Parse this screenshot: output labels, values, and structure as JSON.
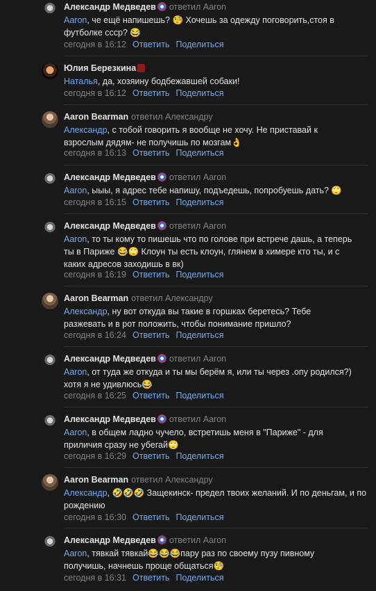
{
  "comments": [
    {
      "author": "Александр Медведев",
      "reply_to": "ответил Aaron",
      "mention": "Aaron",
      "text": ", че ещё напишешь? 🧐 Хочешь за одежду поговорить,стоя в футболке ссср? 😂",
      "date": "сегодня в 16:12",
      "reply_label": "Ответить",
      "share_label": "Поделиться"
    },
    {
      "author": "Юлия Березкина",
      "reply_to": "",
      "mention": "Наталья",
      "text": ", да, хозяину бодбежавшей собаки!",
      "date": "сегодня в 16:12",
      "reply_label": "Ответить",
      "share_label": "Поделиться"
    },
    {
      "author": "Aaron Bearman",
      "reply_to": "ответил Александру",
      "mention": "Александр",
      "text": ", с тобой говорить я вообще не хочу. Не приставай к взрослым дядям- не получишь по мозгам👌",
      "date": "сегодня в 16:13",
      "reply_label": "Ответить",
      "share_label": "Поделиться"
    },
    {
      "author": "Александр Медведев",
      "reply_to": "ответил Aaron",
      "mention": "Aaron",
      "text": ", ыыы, я адрес тебе напишу, подъедешь, попробуешь дать? 🙄",
      "date": "сегодня в 16:15",
      "reply_label": "Ответить",
      "share_label": "Поделиться"
    },
    {
      "author": "Александр Медведев",
      "reply_to": "ответил Aaron",
      "mention": "Aaron",
      "text": ", то ты кому то пишешь что по голове при встрече дашь, а теперь ты в Париже 😂🙄 Клоун ты есть клоун, глянем в химере кто ты, и с каких адресов заходишь в вк)",
      "date": "сегодня в 16:19",
      "reply_label": "Ответить",
      "share_label": "Поделиться"
    },
    {
      "author": "Aaron Bearman",
      "reply_to": "ответил Александру",
      "mention": "Александр",
      "text": ", ну вот откуда вы такие в горшках беретесь? Тебе разжевать и в рот положить, чтобы понимание пришло?",
      "date": "сегодня в 16:24",
      "reply_label": "Ответить",
      "share_label": "Поделиться"
    },
    {
      "author": "Александр Медведев",
      "reply_to": "ответил Aaron",
      "mention": "Aaron",
      "text": ", от туда же откуда и ты мы берём я, или ты через .опу родился?) хотя я не удивлюсь😂",
      "date": "сегодня в 16:25",
      "reply_label": "Ответить",
      "share_label": "Поделиться"
    },
    {
      "author": "Александр Медведев",
      "reply_to": "ответил Aaron",
      "mention": "Aaron",
      "text": ", в общем ладно чучело, встретишь меня в \"Париже\" - для приличия сразу не убегай🙄",
      "date": "сегодня в 16:29",
      "reply_label": "Ответить",
      "share_label": "Поделиться"
    },
    {
      "author": "Aaron Bearman",
      "reply_to": "ответил Александру",
      "mention": "Александр",
      "text": ", 🤣🤣🤣 Защекинск- предел твоих желаний. И по деньгам, и по рождению",
      "date": "сегодня в 16:30",
      "reply_label": "Ответить",
      "share_label": "Поделиться"
    },
    {
      "author": "Александр Медведев",
      "reply_to": "ответил Aaron",
      "mention": "Aaron",
      "text": ", тявкай тявкай😂😂😂пару раз по своему пузу пивному получишь, начнешь проще общаться🧐",
      "date": "сегодня в 16:31",
      "reply_label": "Ответить",
      "share_label": "Поделиться"
    }
  ]
}
